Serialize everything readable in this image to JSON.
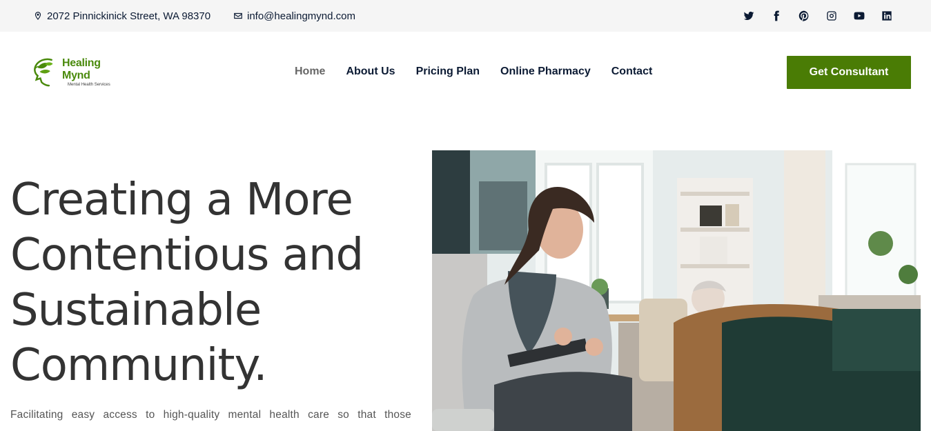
{
  "topbar": {
    "address": "2072 Pinnickinick Street, WA 98370",
    "email": "info@healingmynd.com",
    "socials": [
      "twitter-icon",
      "facebook-icon",
      "pinterest-icon",
      "instagram-icon",
      "youtube-icon",
      "linkedin-icon"
    ]
  },
  "header": {
    "logo": {
      "name": "Healing Mynd",
      "tagline": "Mental Health Services"
    },
    "nav": [
      {
        "label": "Home",
        "active": true
      },
      {
        "label": "About Us",
        "active": false
      },
      {
        "label": "Pricing Plan",
        "active": false
      },
      {
        "label": "Online Pharmacy",
        "active": false
      },
      {
        "label": "Contact",
        "active": false
      }
    ],
    "cta_label": "Get Consultant"
  },
  "hero": {
    "title_lines": [
      "Creating a More",
      "Contentious and",
      "Sustainable",
      "Community."
    ],
    "subtitle": "Facilitating easy access to high-quality mental health care so that those"
  },
  "colors": {
    "brand_green": "#4a7c05",
    "logo_green": "#4a8a0c",
    "navy": "#0b1a33",
    "topbar_bg": "#f5f5f5",
    "heading": "#333333"
  }
}
